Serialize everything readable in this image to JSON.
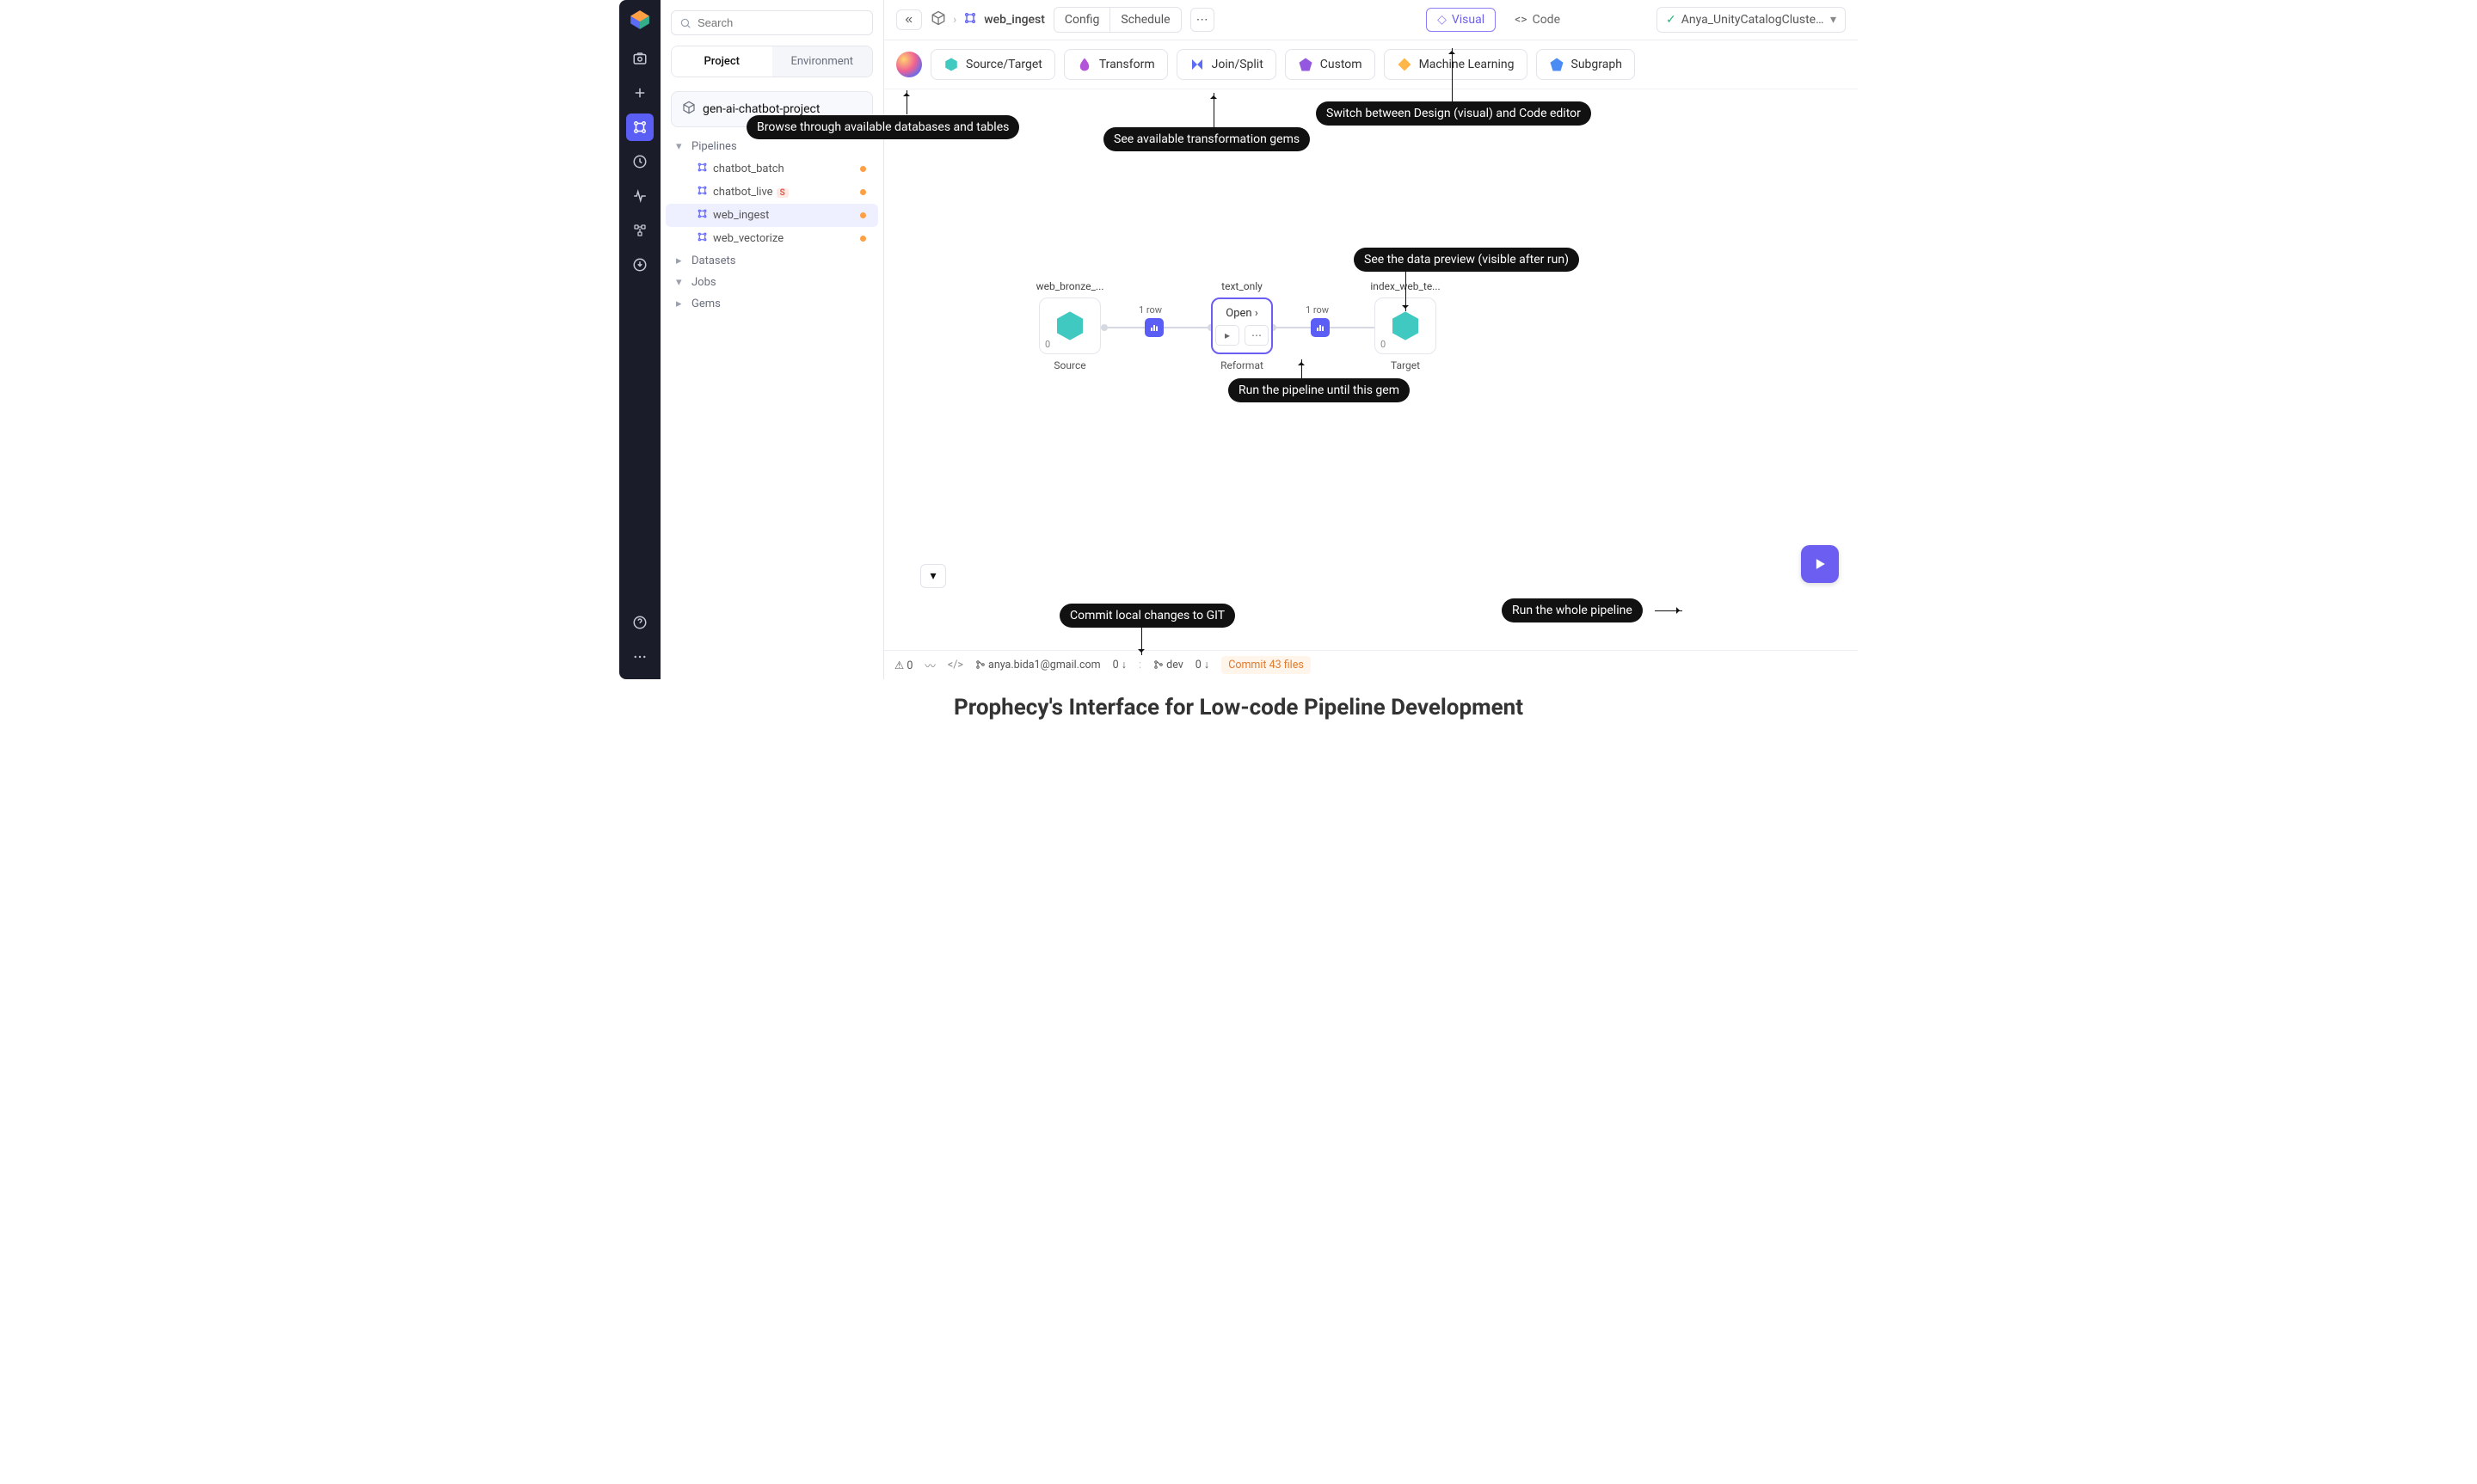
{
  "search": {
    "placeholder": "Search"
  },
  "sidebar_tabs": {
    "project": "Project",
    "environment": "Environment"
  },
  "project": {
    "name": "gen-ai-chatbot-project"
  },
  "tree": {
    "pipelines_label": "Pipelines",
    "datasets_label": "Datasets",
    "jobs_label": "Jobs",
    "gems_label": "Gems",
    "pipelines": [
      {
        "name": "chatbot_batch",
        "badge": "",
        "active": false
      },
      {
        "name": "chatbot_live",
        "badge": "S",
        "active": false
      },
      {
        "name": "web_ingest",
        "badge": "",
        "active": true
      },
      {
        "name": "web_vectorize",
        "badge": "",
        "active": false
      }
    ]
  },
  "topbar": {
    "breadcrumb": "web_ingest",
    "config": "Config",
    "schedule": "Schedule",
    "visual": "Visual",
    "code": "Code",
    "cluster": "Anya_UnityCatalogClusters_U..."
  },
  "gems": {
    "source_target": "Source/Target",
    "transform": "Transform",
    "join_split": "Join/Split",
    "custom": "Custom",
    "ml": "Machine Learning",
    "subgraph": "Subgraph"
  },
  "canvas": {
    "node1": {
      "title": "web_bronze_...",
      "sub": "Source",
      "count": "0"
    },
    "node2": {
      "title": "text_only",
      "open": "Open",
      "sub": "Reformat"
    },
    "node3": {
      "title": "index_web_te...",
      "sub": "Target",
      "count": "0"
    },
    "row1": "1 row",
    "row2": "1 row"
  },
  "annotations": {
    "browse": "Browse through available databases and tables",
    "see_gems": "See available transformation gems",
    "switch": "Switch between Design (visual) and Code editor",
    "preview": "See the data preview (visible after run)",
    "run_until": "Run the pipeline until this gem",
    "commit": "Commit local changes to GIT",
    "run_all": "Run the whole pipeline"
  },
  "footer": {
    "warnings": "0",
    "user": "anya.bida1@gmail.com",
    "branch1_count": "0",
    "branch2": "dev",
    "branch2_count": "0",
    "commit_msg": "Commit 43 files"
  },
  "caption": "Prophecy's Interface for Low-code Pipeline Development"
}
